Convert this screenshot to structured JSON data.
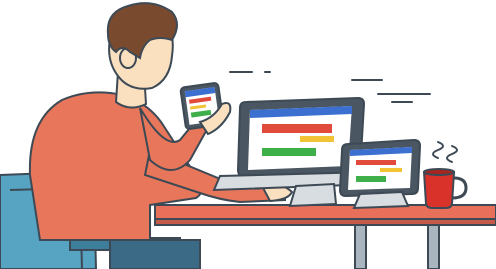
{
  "illustration": {
    "subject": "person-using-multiple-devices",
    "devices": [
      "smartphone",
      "laptop",
      "tablet"
    ],
    "objects": [
      "office-chair",
      "desk",
      "coffee-mug"
    ],
    "colors": {
      "background": "#ffffff",
      "outline": "#3d4a55",
      "skin": "#fbe0c0",
      "hair": "#7a4a2f",
      "shirt": "#e8765a",
      "pants": "#3a6a85",
      "chair": "#56a3c2",
      "desk_top": "#e8705a",
      "desk_legs": "#a9b6bf",
      "device_body": "#d8dde1",
      "screen_header": "#3b6fd0",
      "screen_red": "#e04b3b",
      "screen_yellow": "#f2c335",
      "screen_green": "#3faf4a",
      "mug": "#d9322b"
    }
  }
}
